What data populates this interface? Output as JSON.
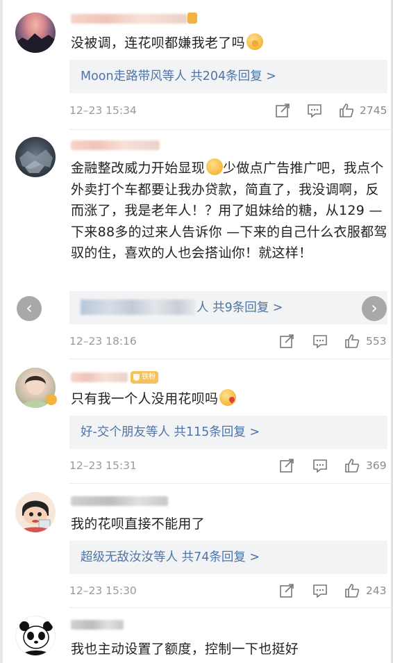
{
  "comments": [
    {
      "text": "没被调，连花呗都嫌我老了吗",
      "reply": {
        "names": "Moon走路带风等人",
        "count": "共204条回复 >"
      },
      "time": "12–23 15:34",
      "likes": "2745"
    },
    {
      "text_a": "金融整改威力开始显现",
      "text_b": "少做点广告推广吧，我点个外卖打个车都要让我办贷款，简直了，我没调啊，反而涨了，我是老年人！？用了姐妹给的糖，从129 —下来88多的过来人告诉你 —下来的自己什么衣服都驾驭的住，喜欢的人也会搭讪你！就这样！",
      "reply": {
        "names_suffix": "人",
        "count": "共9条回复 >"
      },
      "time": "12–23 18:16",
      "likes": "553"
    },
    {
      "badge": "铁粉",
      "text": "只有我一个人没用花呗吗",
      "reply": {
        "names": "好-交个朋友等人",
        "count": "共115条回复 >"
      },
      "time": "12–23 15:31",
      "likes": "369"
    },
    {
      "text": "我的花呗直接不能用了",
      "reply": {
        "names": "超级无敌汝汝等人",
        "count": "共74条回复 >"
      },
      "time": "12–23 15:30",
      "likes": "243"
    },
    {
      "text": "我也主动设置了额度，控制一下也挺好"
    }
  ],
  "nav": {
    "prev": "‹",
    "next": "›"
  },
  "icons": [
    "share-icon",
    "comment-icon",
    "like-icon",
    "fan-badge-icon"
  ],
  "colors": {
    "link": "#4e74a6",
    "meta": "#9a9a9a",
    "reply_bg": "#f2f3f5"
  }
}
